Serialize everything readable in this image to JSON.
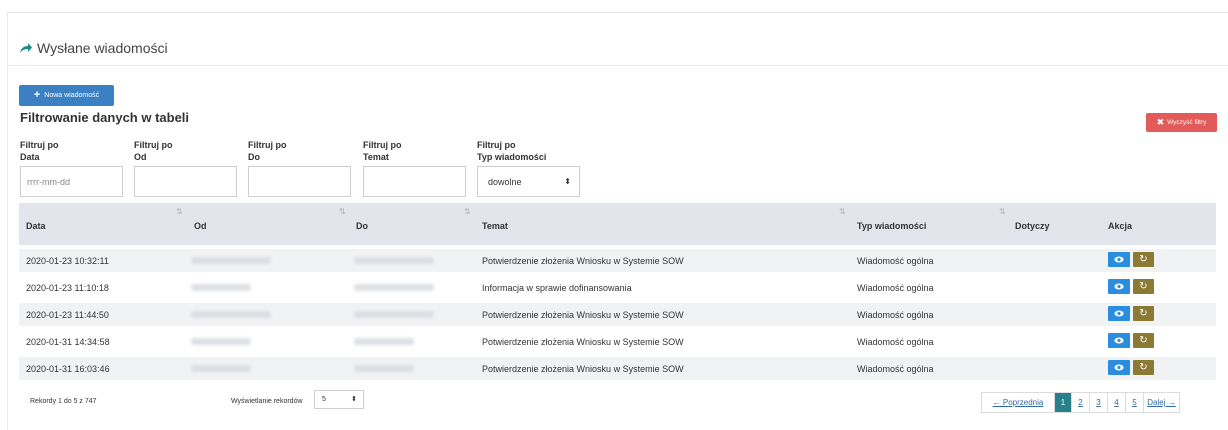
{
  "panel": {
    "title": "Wysłane wiadomości"
  },
  "toolbar": {
    "new_message_label": "Nowa wiadomość",
    "clear_filters_label": "Wyczyść filtry"
  },
  "filters": {
    "heading": "Filtrowanie danych w tabeli",
    "items": [
      {
        "line1": "Filtruj po",
        "line2": "Data",
        "placeholder": "rrrr-mm-dd",
        "value": ""
      },
      {
        "line1": "Filtruj po",
        "line2": "Od",
        "placeholder": "",
        "value": ""
      },
      {
        "line1": "Filtruj po",
        "line2": "Do",
        "placeholder": "",
        "value": ""
      },
      {
        "line1": "Filtruj po",
        "line2": "Temat",
        "placeholder": "",
        "value": ""
      },
      {
        "line1": "Filtruj po",
        "line2": "Typ wiadomości",
        "selected": "dowolne"
      }
    ]
  },
  "table": {
    "headers": [
      "Data",
      "Od",
      "Do",
      "Temat",
      "Typ wiadomości",
      "Dotyczy",
      "Akcja"
    ],
    "rows": [
      {
        "date": "2020-01-23 10:32:11",
        "subject": "Potwierdzenie złożenia Wniosku w Systemie SOW",
        "type": "Wiadomość ogólna"
      },
      {
        "date": "2020-01-23 11:10:18",
        "subject": "Informacja w sprawie dofinansowania",
        "type": "Wiadomość ogólna"
      },
      {
        "date": "2020-01-23 11:44:50",
        "subject": "Potwierdzenie złożenia Wniosku w Systemie SOW",
        "type": "Wiadomość ogólna"
      },
      {
        "date": "2020-01-31 14:34:58",
        "subject": "Potwierdzenie złożenia Wniosku w Systemie SOW",
        "type": "Wiadomość ogólna"
      },
      {
        "date": "2020-01-31 16:03:46",
        "subject": "Potwierdzenie złożenia Wniosku w Systemie SOW",
        "type": "Wiadomość ogólna"
      }
    ]
  },
  "footer": {
    "info": "Rekordy 1 do 5 z 747",
    "length_label": "Wyświetlanie rekordów",
    "length_value": "5",
    "pager": [
      "← Poprzednia",
      "1",
      "2",
      "3",
      "4",
      "5",
      "Dalej →"
    ],
    "active_page": "1"
  },
  "colors": {
    "primary": "#3a80c2",
    "danger": "#e25a5a",
    "view": "#2b8de0",
    "refresh": "#8a7a34",
    "active_page": "#28818a"
  },
  "icons": {
    "title": "share-arrow-icon",
    "new": "plus-icon",
    "clear": "x-icon",
    "view": "eye-icon",
    "refresh": "refresh-icon",
    "sort": "sort-icon"
  }
}
